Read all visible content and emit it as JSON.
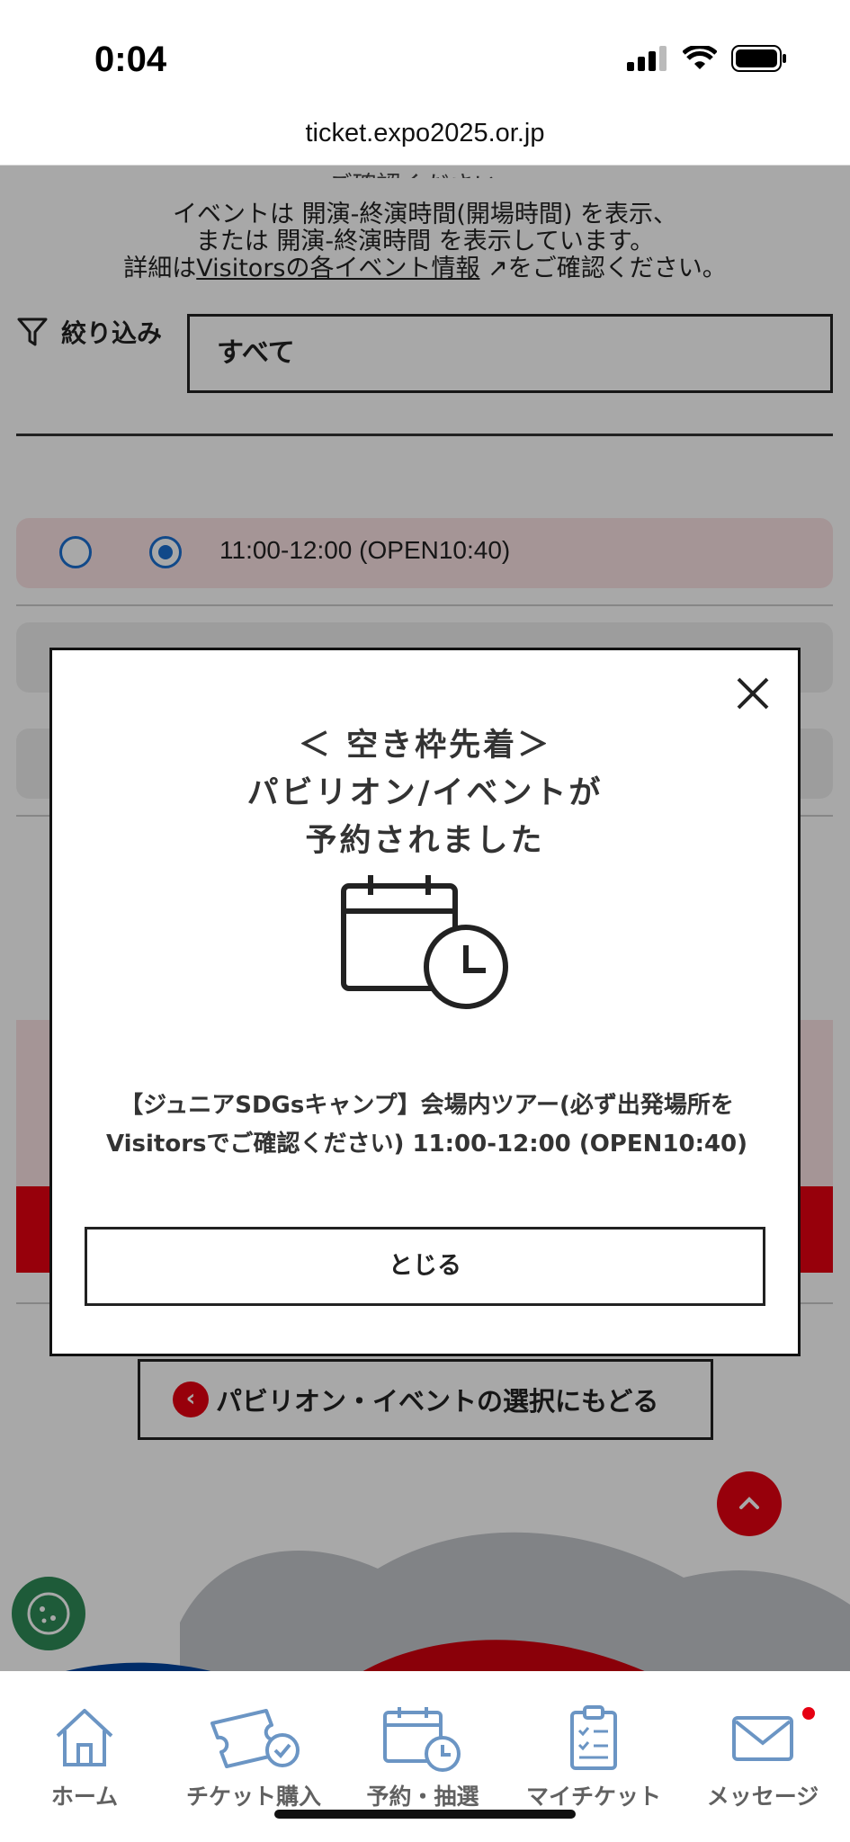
{
  "status_bar": {
    "time": "0:04"
  },
  "browser": {
    "url": "ticket.expo2025.or.jp"
  },
  "intro": {
    "line0": "ご確認ください。",
    "line1": "イベントは 開演-終演時間(開場時間) を表示、",
    "line2": "または 開演-終演時間 を表示しています。",
    "line3_prefix": "詳細は",
    "line3_link": "Visitorsの各イベント情報",
    "line3_suffix": "をご確認ください。"
  },
  "filter": {
    "label": "絞り込み",
    "value": "すべて"
  },
  "slots": [
    {
      "time": "11:00-12:00 (OPEN10:40)"
    }
  ],
  "back_button": {
    "label": "パビリオン・イベントの選択にもどる"
  },
  "modal": {
    "title_line1": "＜ 空き枠先着＞",
    "title_line2": "パビリオン/イベントが",
    "title_line3": "予約されました",
    "message_line1": "【ジュニアSDGsキャンプ】会場内ツアー(必ず出発場所を",
    "message_line2": "Visitorsでご確認ください) 11:00-12:00 (OPEN10:40)",
    "close_label": "とじる"
  },
  "bottom_nav": {
    "items": [
      {
        "label": "ホーム",
        "icon": "home-icon"
      },
      {
        "label": "チケット購入",
        "icon": "ticket-purchase-icon"
      },
      {
        "label": "予約・抽選",
        "icon": "calendar-clock-icon"
      },
      {
        "label": "マイチケット",
        "icon": "clipboard-icon"
      },
      {
        "label": "メッセージ",
        "icon": "mail-icon"
      }
    ]
  },
  "colors": {
    "accent_red": "#e60012",
    "blue": "#1a6fd1",
    "nav_blue": "#1f5fa6"
  }
}
